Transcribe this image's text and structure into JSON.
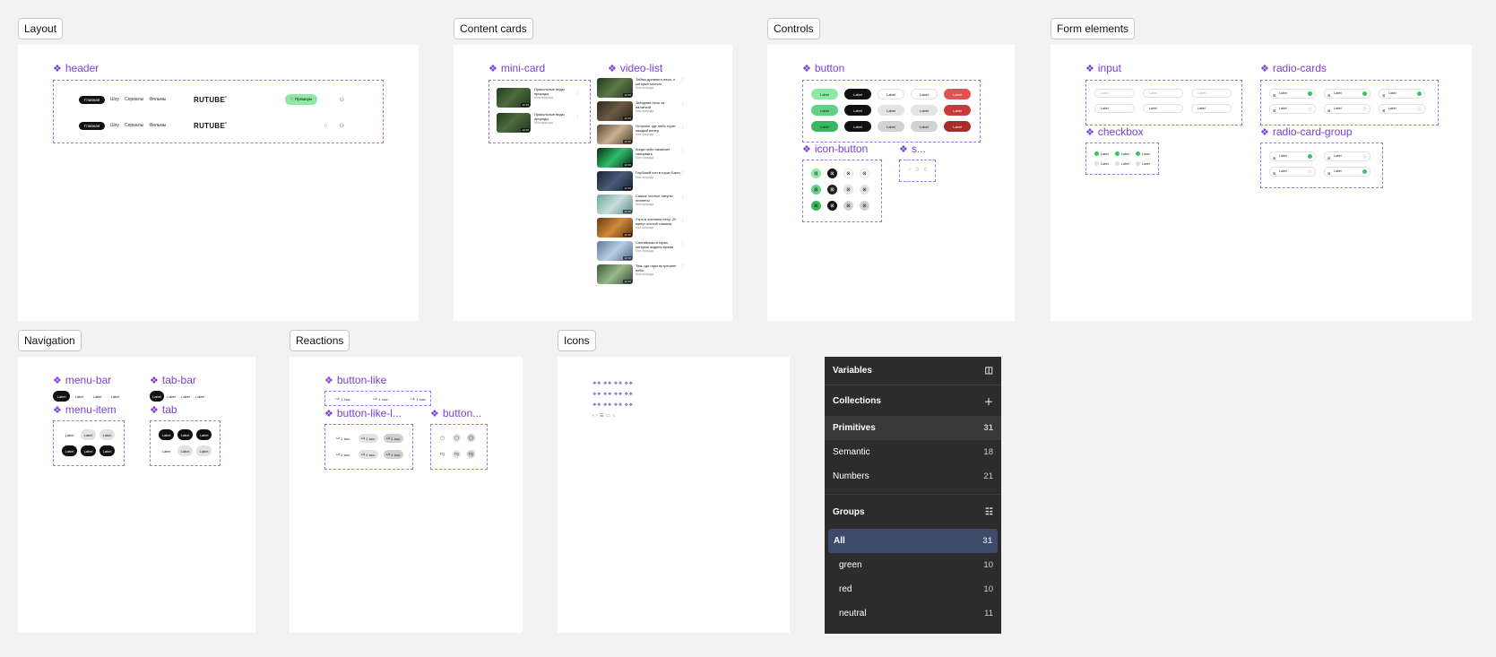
{
  "sections": {
    "layout": "Layout",
    "content_cards": "Content cards",
    "controls": "Controls",
    "form_elements": "Form elements",
    "navigation": "Navigation",
    "reactions": "Reactions",
    "icons": "Icons"
  },
  "components": {
    "header": "header",
    "mini_card": "mini-card",
    "video_list": "video-list",
    "button": "button",
    "icon_button": "icon-button",
    "s": "s...",
    "input": "input",
    "radio_cards": "radio-cards",
    "checkbox": "checkbox",
    "radio_card_group": "radio-card-group",
    "menu_bar": "menu-bar",
    "tab_bar": "tab-bar",
    "menu_item": "menu-item",
    "tab": "tab",
    "button_like": "button-like",
    "button_like_l": "button-like-l...",
    "button_ell": "button..."
  },
  "header_preview": {
    "main_tab": "Главная",
    "nav": [
      "Шоу",
      "Сериалы",
      "Фильмы"
    ],
    "logo": "RUTUBE",
    "premium": "Премиум"
  },
  "mini_cards": [
    {
      "title": "Прикольные виды природы",
      "meta": "Моя природа",
      "dur": "12:15"
    },
    {
      "title": "Прикольные виды природы",
      "meta": "Моя природа",
      "dur": "12:15"
    }
  ],
  "video_list": [
    {
      "title": "Тайны древнего леса, о которых молчат",
      "meta": "Моя природа",
      "dur": "12:15",
      "bg": "linear-gradient(135deg,#1f3a22,#5b7a45 50%,#263820)"
    },
    {
      "title": "Звёздная ночь за палаткой",
      "meta": "Моя природа",
      "dur": "12:15",
      "bg": "linear-gradient(135deg,#2f2a22,#6a5a44 50%,#2a2118)"
    },
    {
      "title": "Острова, где небо горит каждый вечер",
      "meta": "Моя природа",
      "dur": "12:15",
      "bg": "linear-gradient(135deg,#5a4a3a,#c8b090 50%,#4a3c2c)"
    },
    {
      "title": "Когда небо начинает танцевать",
      "meta": "Моя природа",
      "dur": "12:15",
      "bg": "linear-gradient(135deg,#0e2a1c,#2fbf6a 50%,#0a1e18)"
    },
    {
      "title": "Глубокий сон в горах Бали",
      "meta": "Моя природа",
      "dur": "12:15",
      "bg": "linear-gradient(135deg,#1c2434,#4a5a7a 50%,#181f2e)"
    },
    {
      "title": "Самые чистые лагуны планеты",
      "meta": "Моя природа",
      "dur": "12:15",
      "bg": "linear-gradient(135deg,#6aa8a0,#c8ded8 50%,#5a8c8a)"
    },
    {
      "title": "Утро в осеннем лесу: 20 минут чистой тишины",
      "meta": "Моя природа",
      "dur": "12:15",
      "bg": "linear-gradient(135deg,#6a3a12,#d08a3a 50%,#5a2e10)"
    },
    {
      "title": "Снегийская в горах, которые видели время",
      "meta": "Моя природа",
      "dur": "12:15",
      "bg": "linear-gradient(135deg,#5a7a9a,#b8cce0 50%,#4a6a88)"
    },
    {
      "title": "Там, где горы встречают небо",
      "meta": "Моя природа",
      "dur": "12:15",
      "bg": "linear-gradient(135deg,#3a5a3a,#9ab88a 50%,#2e4a2e)"
    }
  ],
  "button_label": "Label",
  "input_placeholder": "Label",
  "like_label": "1 тыс.",
  "variables_panel": {
    "title": "Variables",
    "collections": "Collections",
    "collection_items": [
      {
        "label": "Primitives",
        "count": "31"
      },
      {
        "label": "Semantic",
        "count": "18"
      },
      {
        "label": "Numbers",
        "count": "21"
      }
    ],
    "groups": "Groups",
    "group_items": [
      {
        "label": "All",
        "count": "31"
      },
      {
        "label": "green",
        "count": "10"
      },
      {
        "label": "red",
        "count": "10"
      },
      {
        "label": "neutral",
        "count": "11"
      }
    ]
  }
}
